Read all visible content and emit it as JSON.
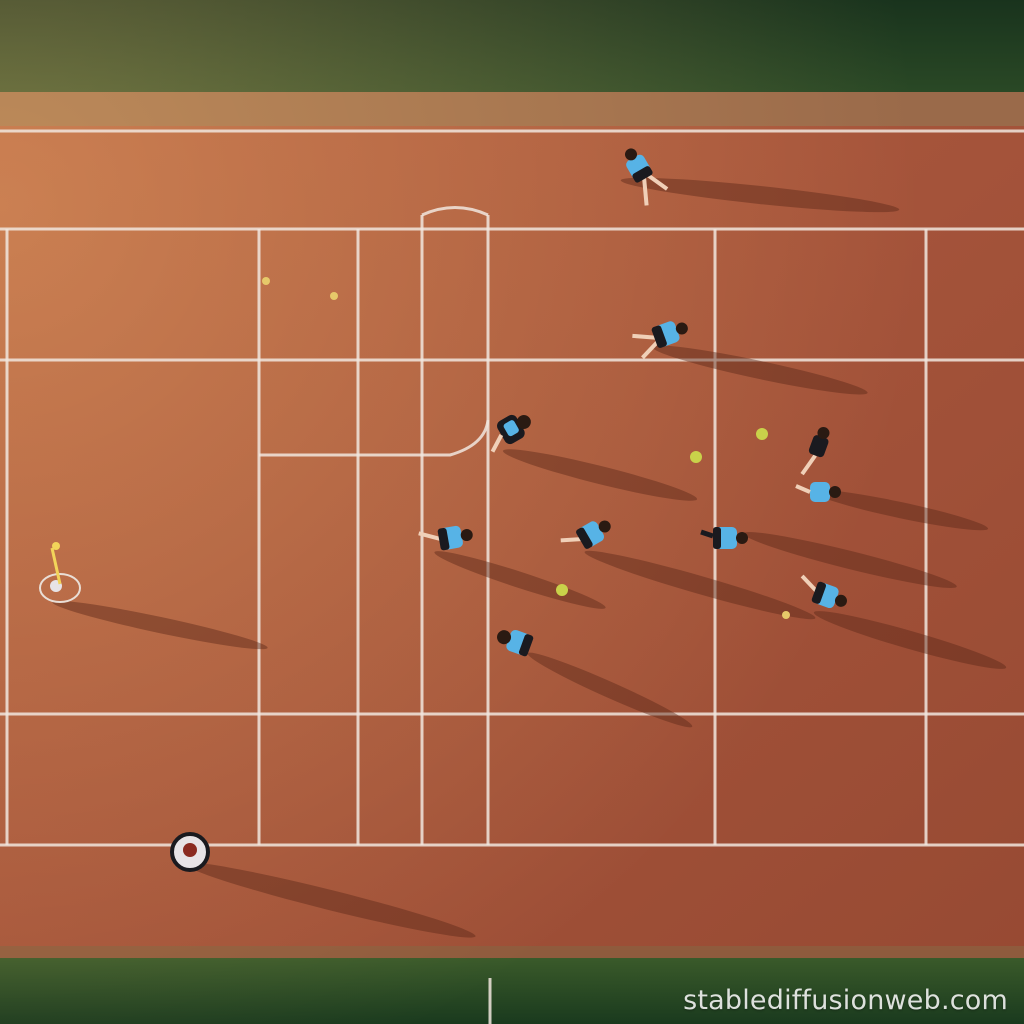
{
  "image": {
    "subject": "aerial view of players on a clay court",
    "watermark": "stablediffusionweb.com"
  },
  "colors": {
    "grass": "#1e3f24",
    "clay": "#a4533a",
    "clay_light": "#b5654a",
    "line": "#f1e6de",
    "jersey": "#57b3e6",
    "shorts": "#1a1a1f",
    "ball": "#c9d24a"
  }
}
